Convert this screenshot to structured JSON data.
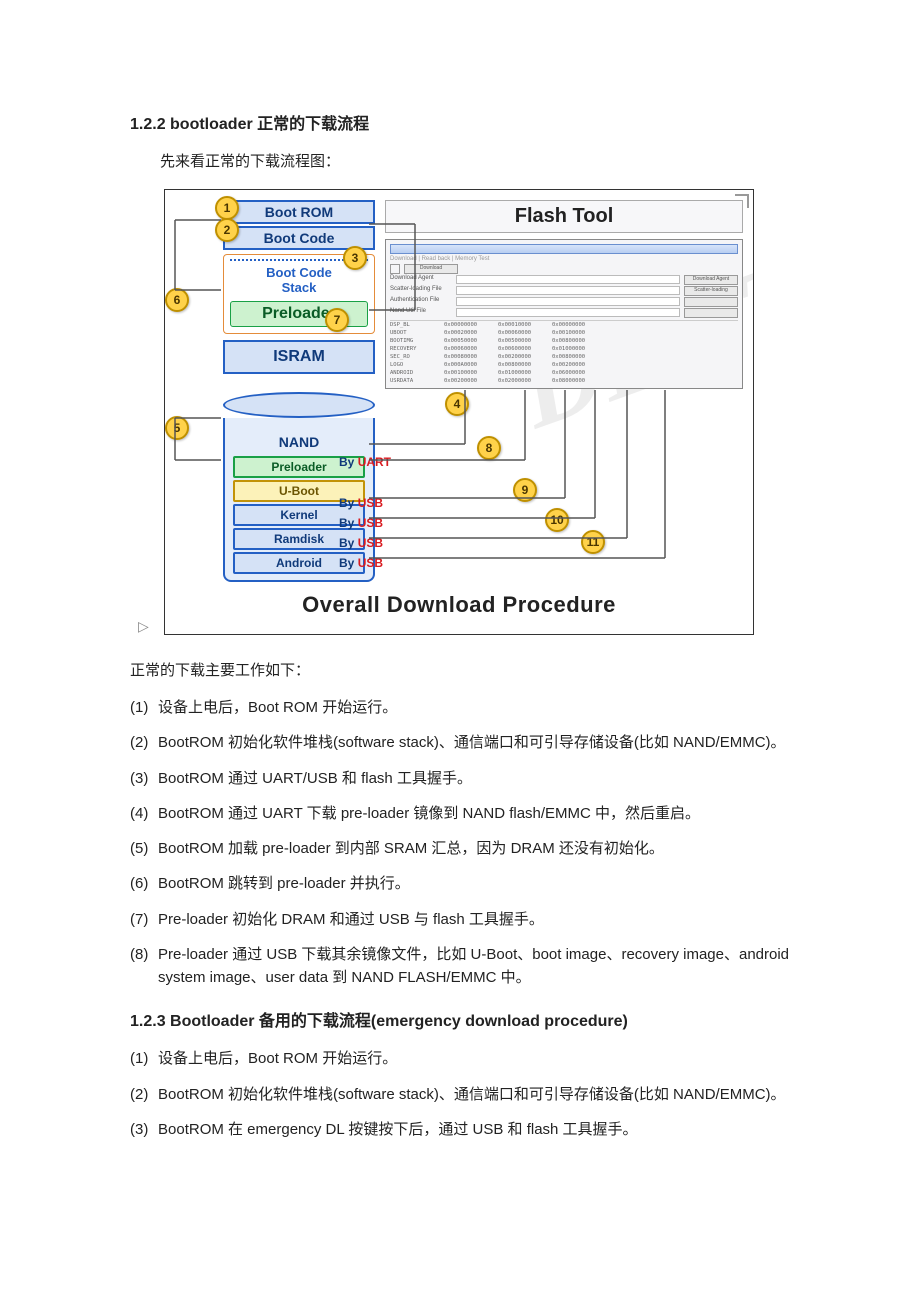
{
  "section122": {
    "heading": "1.2.2 bootloader 正常的下载流程"
  },
  "lead1": "先来看正常的下载流程图：",
  "diagram": {
    "watermark": "DENT",
    "bootRom": "Boot ROM",
    "bootCode": "Boot Code",
    "bootCodeStack": "Boot Code\nStack",
    "preloader": "Preloader",
    "isram": "ISRAM",
    "nand": "NAND",
    "nand_preloader": "Preloader",
    "nand_uboot": "U-Boot",
    "nand_kernel": "Kernel",
    "nand_ramdisk": "Ramdisk",
    "nand_android": "Android",
    "flash_title": "Flash Tool",
    "fw_tabs": "Download | Read back | Memory Test",
    "fw_download_btn": "Download",
    "fw_fields": [
      "Download Agent",
      "Scatter-loading File",
      "Authentication File",
      "Nand Util File"
    ],
    "fw_table": [
      {
        "name": "DSP_BL",
        "c1": "0x00000000",
        "c2": "0x00010000",
        "c3": "0x00000000"
      },
      {
        "name": "UBOOT",
        "c1": "0x00020000",
        "c2": "0x00060000",
        "c3": "0x00100000"
      },
      {
        "name": "BOOTIMG",
        "c1": "0x00050000",
        "c2": "0x00500000",
        "c3": "0x00800000"
      },
      {
        "name": "RECOVERY",
        "c1": "0x00060000",
        "c2": "0x00600000",
        "c3": "0x01000000"
      },
      {
        "name": "SEC_RO",
        "c1": "0x00080000",
        "c2": "0x00200000",
        "c3": "0x00800000"
      },
      {
        "name": "LOGO",
        "c1": "0x000A0000",
        "c2": "0x00800000",
        "c3": "0x00200000"
      },
      {
        "name": "ANDROID",
        "c1": "0x00100000",
        "c2": "0x01000000",
        "c3": "0x06000000"
      },
      {
        "name": "USRDATA",
        "c1": "0x00200000",
        "c2": "0x02000000",
        "c3": "0x08000000"
      }
    ],
    "by_uart": "By UART",
    "by_usb": "By USB",
    "caption": "Overall Download Procedure",
    "badges": {
      "b1": "1",
      "b2": "2",
      "b3": "3",
      "b4": "4",
      "b5": "5",
      "b6": "6",
      "b7": "7",
      "b8": "8",
      "b9": "9",
      "b10": "10",
      "b11": "11"
    }
  },
  "after1": "正常的下载主要工作如下：",
  "normal_steps": [
    "(1)  设备上电后，Boot ROM 开始运行。",
    "(2)  BootROM 初始化软件堆栈(software stack)、通信端口和可引导存储设备(比如 NAND/EMMC)。",
    "(3)  BootROM 通过 UART/USB 和 flash 工具握手。",
    "(4)  BootROM 通过 UART 下载 pre-loader 镜像到 NAND flash/EMMC 中，然后重启。",
    "(5)  BootROM 加载 pre-loader 到内部 SRAM 汇总，因为 DRAM 还没有初始化。",
    "(6)  BootROM 跳转到 pre-loader 并执行。",
    "(7)  Pre-loader 初始化 DRAM 和通过 USB 与 flash 工具握手。",
    "(8)  Pre-loader 通过 USB 下载其余镜像文件，比如 U-Boot、boot image、recovery image、android system image、user data 到 NAND FLASH/EMMC 中。"
  ],
  "section123": {
    "heading": "1.2.3 Bootloader 备用的下载流程(emergency download procedure)"
  },
  "emergency_steps": [
    "(1)  设备上电后，Boot ROM 开始运行。",
    "(2)  BootROM 初始化软件堆栈(software stack)、通信端口和可引导存储设备(比如 NAND/EMMC)。",
    "(3)  BootROM 在 emergency DL 按键按下后，通过 USB 和 flash 工具握手。"
  ]
}
